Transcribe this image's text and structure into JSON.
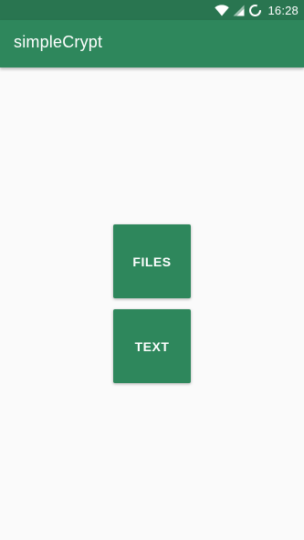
{
  "status_bar": {
    "time": "16:28",
    "icons": [
      "wifi-icon",
      "cell-signal-icon",
      "sync-icon"
    ],
    "color": "#297550"
  },
  "app_bar": {
    "title": "simpleCrypt",
    "color": "#2e875c"
  },
  "main": {
    "buttons": [
      {
        "label": "FILES"
      },
      {
        "label": "TEXT"
      }
    ],
    "button_color": "#2e875c",
    "background": "#fafafa"
  }
}
